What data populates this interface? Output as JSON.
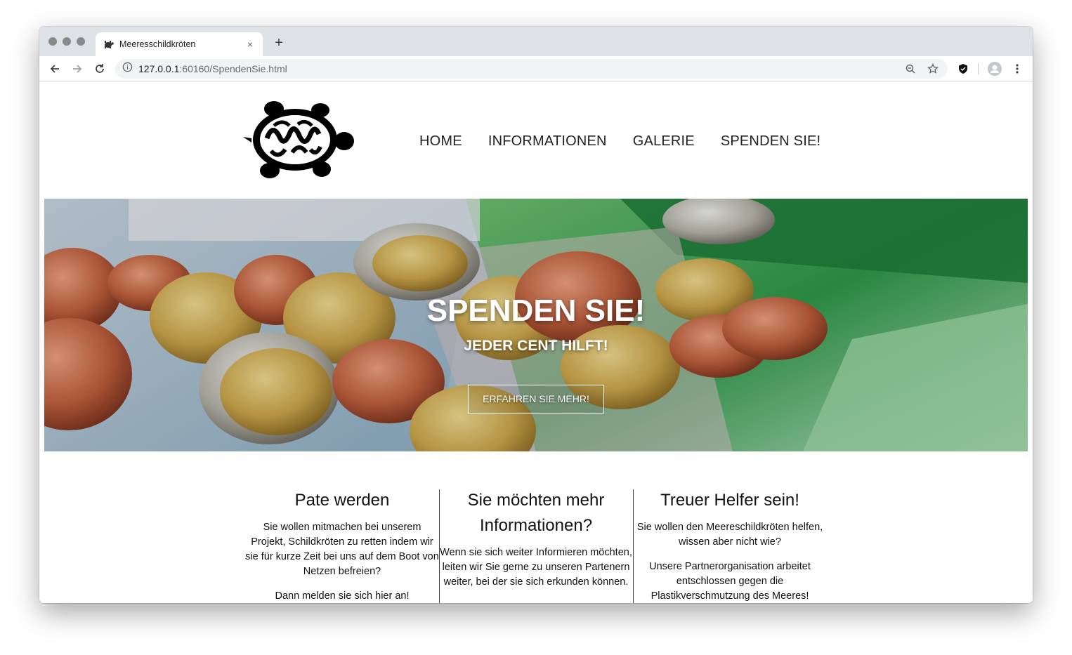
{
  "browser": {
    "tab_title": "Meeresschildkröten",
    "new_tab": "+",
    "close_tab": "×",
    "url_host": "127.0.0.1",
    "url_rest": ":60160/SpendenSie.html"
  },
  "nav": {
    "items": [
      {
        "label": "HOME"
      },
      {
        "label": "INFORMATIONEN"
      },
      {
        "label": "GALERIE"
      },
      {
        "label": "SPENDEN SIE!"
      }
    ]
  },
  "hero": {
    "title": "SPENDEN SIE!",
    "subtitle": "JEDER CENT HILFT!",
    "button": "ERFAHREN SIE MEHR!"
  },
  "columns": [
    {
      "heading": "Pate werden",
      "paragraphs": [
        "Sie wollen mitmachen bei unserem Projekt, Schildkröten zu retten indem wir sie für kurze Zeit bei uns auf dem Boot von Netzen befreien?",
        "Dann melden sie sich hier an!"
      ]
    },
    {
      "heading": "Sie möchten mehr Informationen?",
      "paragraphs": [
        "Wenn sie sich weiter Informieren möchten, leiten wir Sie gerne zu unseren Partenern weiter, bei der sie sich erkunden können."
      ]
    },
    {
      "heading": "Treuer Helfer sein!",
      "paragraphs": [
        "Sie wollen den Meereschildkröten helfen, wissen aber nicht wie?",
        "Unsere Partnerorganisation arbeitet entschlossen gegen die Plastikverschmutzung des Meeres!"
      ]
    }
  ],
  "icons": [
    "back-icon",
    "forward-icon",
    "reload-icon",
    "info-icon",
    "zoom-icon",
    "star-icon",
    "shield-icon",
    "profile-icon",
    "menu-icon",
    "turtle-logo"
  ]
}
